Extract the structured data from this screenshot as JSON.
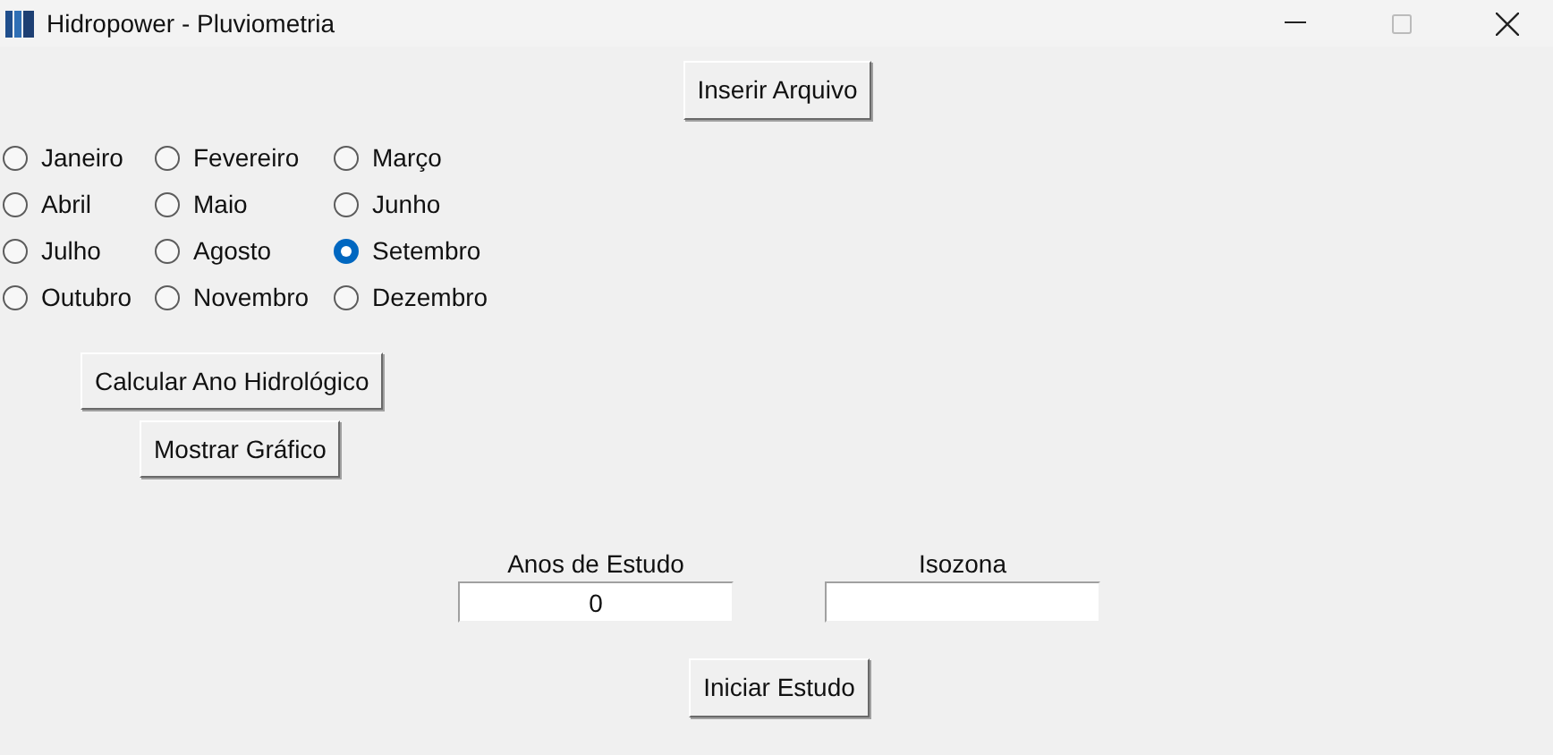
{
  "window": {
    "title": "Hidropower - Pluviometria"
  },
  "insert_button": "Inserir Arquivo",
  "months": [
    {
      "label": "Janeiro",
      "selected": false
    },
    {
      "label": "Fevereiro",
      "selected": false
    },
    {
      "label": "Março",
      "selected": false
    },
    {
      "label": "Abril",
      "selected": false
    },
    {
      "label": "Maio",
      "selected": false
    },
    {
      "label": "Junho",
      "selected": false
    },
    {
      "label": "Julho",
      "selected": false
    },
    {
      "label": "Agosto",
      "selected": false
    },
    {
      "label": "Setembro",
      "selected": true
    },
    {
      "label": "Outubro",
      "selected": false
    },
    {
      "label": "Novembro",
      "selected": false
    },
    {
      "label": "Dezembro",
      "selected": false
    }
  ],
  "calc_button": "Calcular Ano Hidrológico",
  "chart_button": "Mostrar Gráfico",
  "fields": [
    {
      "label": "Anos de Estudo",
      "value": "0"
    },
    {
      "label": "Isozona"
    }
  ],
  "start_button": "Iniciar Estudo"
}
